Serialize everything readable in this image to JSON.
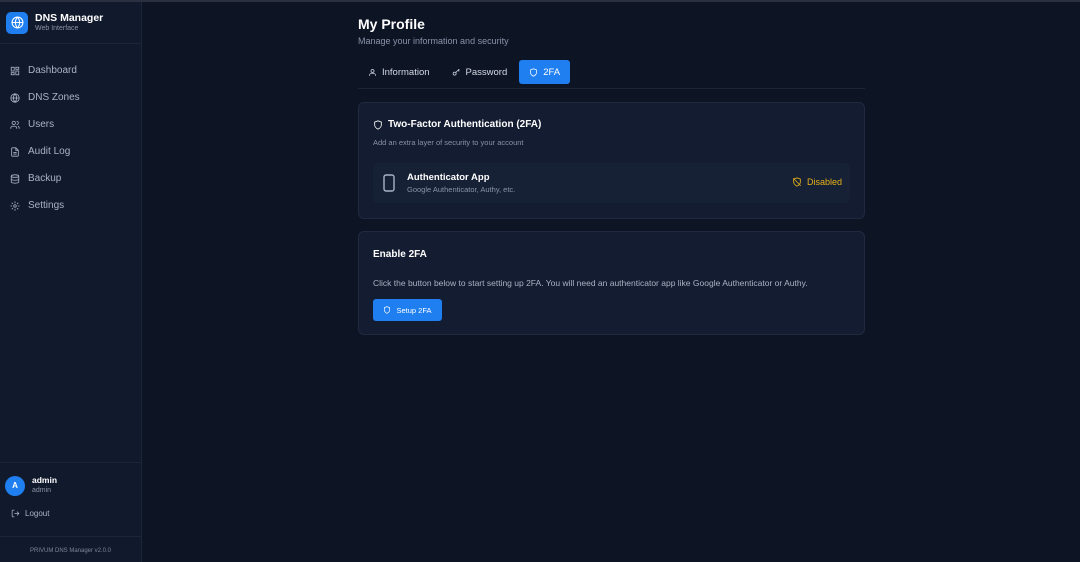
{
  "app": {
    "title": "DNS Manager",
    "subtitle": "Web Interface",
    "version": "PRIVUM DNS Manager v2.0.0"
  },
  "sidebar": {
    "items": [
      {
        "label": "Dashboard",
        "icon": "dashboard-icon"
      },
      {
        "label": "DNS Zones",
        "icon": "globe-icon"
      },
      {
        "label": "Users",
        "icon": "users-icon"
      },
      {
        "label": "Audit Log",
        "icon": "file-icon"
      },
      {
        "label": "Backup",
        "icon": "database-icon"
      },
      {
        "label": "Settings",
        "icon": "gear-icon"
      }
    ],
    "user": {
      "initial": "A",
      "name": "admin",
      "role": "admin"
    },
    "logout_label": "Logout"
  },
  "page": {
    "title": "My Profile",
    "subtitle": "Manage your information and security"
  },
  "tabs": [
    {
      "label": "Information",
      "active": false
    },
    {
      "label": "Password",
      "active": false
    },
    {
      "label": "2FA",
      "active": true
    }
  ],
  "twofa": {
    "title": "Two-Factor Authentication (2FA)",
    "description": "Add an extra layer of security to your account",
    "method_name": "Authenticator App",
    "method_sub": "Google Authenticator, Authy, etc.",
    "status": "Disabled"
  },
  "enable": {
    "title": "Enable 2FA",
    "description": "Click the button below to start setting up 2FA. You will need an authenticator app like Google Authenticator or Authy.",
    "button_label": "Setup 2FA"
  },
  "colors": {
    "accent": "#1f7ff0",
    "warning": "#e6b217",
    "background": "#0d1424",
    "sidebar": "#111a2c"
  }
}
